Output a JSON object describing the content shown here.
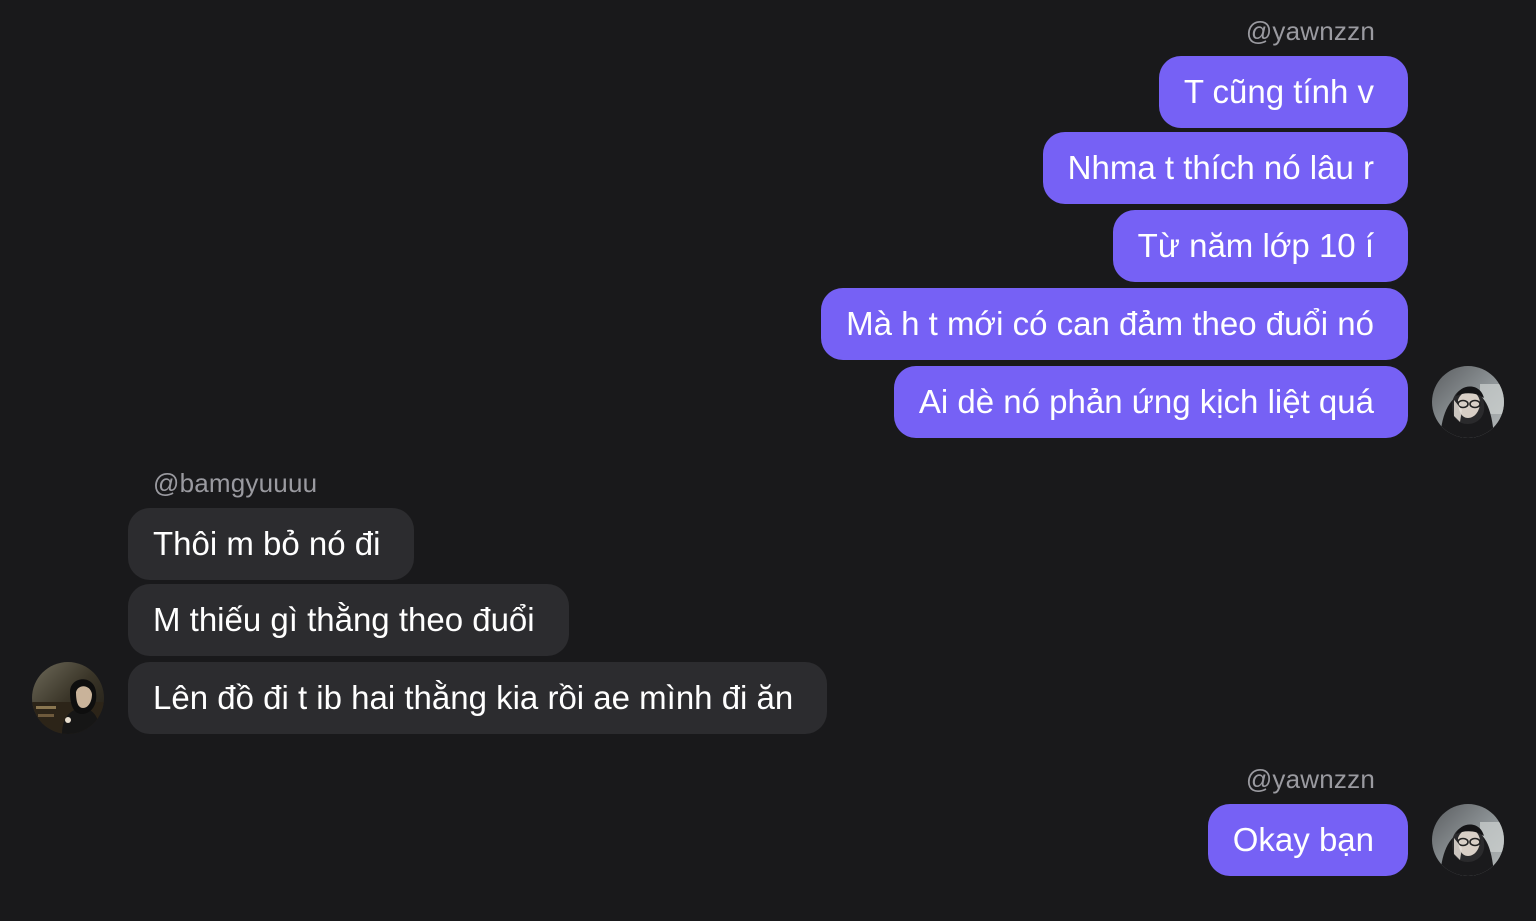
{
  "colors": {
    "background": "#19191b",
    "outgoing_bubble": "#7661f5",
    "incoming_bubble": "#2c2c2f",
    "username_text": "#9a9aa0",
    "message_text": "#ffffff"
  },
  "groups": [
    {
      "username": "@yawnzzn",
      "direction": "outgoing",
      "avatar_icon": "user-avatar-dark-hood",
      "messages": [
        "T cũng tính v",
        "Nhma t thích nó lâu r",
        "Từ năm lớp 10 í",
        "Mà h t mới có can đảm theo đuổi nó",
        "Ai dè nó phản ứng kịch liệt quá"
      ]
    },
    {
      "username": "@bamgyuuuu",
      "direction": "incoming",
      "avatar_icon": "user-avatar-warm-photo",
      "messages": [
        "Thôi m bỏ nó đi",
        "M thiếu gì thằng theo đuổi",
        "Lên đồ đi t ib hai thằng kia rồi ae mình đi ăn"
      ]
    },
    {
      "username": "@yawnzzn",
      "direction": "outgoing",
      "avatar_icon": "user-avatar-dark-hood",
      "messages": [
        "Okay bạn"
      ]
    }
  ]
}
